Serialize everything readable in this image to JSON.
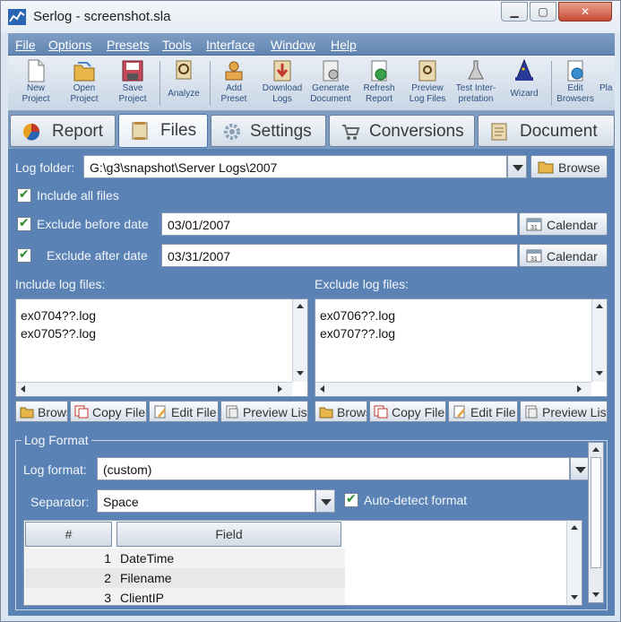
{
  "window": {
    "title": "Serlog - screenshot.sla",
    "minimize_label": "▁",
    "maximize_label": "▢",
    "close_label": "✕"
  },
  "menu": [
    "File",
    "Options",
    "Presets",
    "Tools",
    "Interface",
    "Window",
    "Help"
  ],
  "toolbar": [
    {
      "label1": "New",
      "label2": "Project",
      "icon": "new-project-icon"
    },
    {
      "label1": "Open",
      "label2": "Project",
      "icon": "open-project-icon"
    },
    {
      "label1": "Save",
      "label2": "Project",
      "icon": "save-project-icon"
    },
    {
      "label1": "Analyze",
      "label2": "",
      "icon": "analyze-icon"
    },
    {
      "label1": "Add",
      "label2": "Preset",
      "icon": "add-preset-icon"
    },
    {
      "label1": "Download",
      "label2": "Logs",
      "icon": "download-logs-icon"
    },
    {
      "label1": "Generate",
      "label2": "Document",
      "icon": "generate-document-icon"
    },
    {
      "label1": "Refresh",
      "label2": "Report",
      "icon": "refresh-report-icon"
    },
    {
      "label1": "Preview",
      "label2": "Log Files",
      "icon": "preview-log-files-icon"
    },
    {
      "label1": "Test Inter-",
      "label2": "pretation",
      "icon": "test-interpretation-icon"
    },
    {
      "label1": "Wizard",
      "label2": "",
      "icon": "wizard-icon"
    },
    {
      "label1": "Edit",
      "label2": "Browsers",
      "icon": "edit-browsers-icon"
    },
    {
      "label1": "",
      "label2": "Pla",
      "icon": ""
    }
  ],
  "tabs": [
    {
      "label": "Report",
      "icon": "report-icon"
    },
    {
      "label": "Files",
      "icon": "files-icon"
    },
    {
      "label": "Settings",
      "icon": "settings-icon"
    },
    {
      "label": "Conversions",
      "icon": "conversions-icon"
    },
    {
      "label": "Document",
      "icon": "document-icon"
    }
  ],
  "files": {
    "log_folder_label": "Log folder:",
    "log_folder_value": "G:\\g3\\snapshot\\Server Logs\\2007",
    "browse_label": "Browse",
    "include_all_label": "Include all files",
    "exclude_before_label": "Exclude before date",
    "exclude_before_value": "03/01/2007",
    "exclude_after_label": "Exclude after date",
    "exclude_after_value": "03/31/2007",
    "calendar_label": "Calendar",
    "include_list_label": "Include log files:",
    "exclude_list_label": "Exclude log files:",
    "include_files": [
      "ex0704??.log",
      "ex0705??.log"
    ],
    "exclude_files": [
      "ex0706??.log",
      "ex0707??.log"
    ],
    "list_buttons": [
      "Browse",
      "Copy File",
      "Edit File",
      "Preview List"
    ]
  },
  "log_format": {
    "group_label": "Log Format",
    "format_label": "Log format:",
    "format_value": "(custom)",
    "separator_label": "Separator:",
    "separator_value": "Space",
    "autodetect_label": "Auto-detect format",
    "columns": [
      "#",
      "Field"
    ],
    "rows": [
      {
        "num": "1",
        "field": "DateTime"
      },
      {
        "num": "2",
        "field": "Filename"
      },
      {
        "num": "3",
        "field": "ClientIP"
      }
    ]
  }
}
